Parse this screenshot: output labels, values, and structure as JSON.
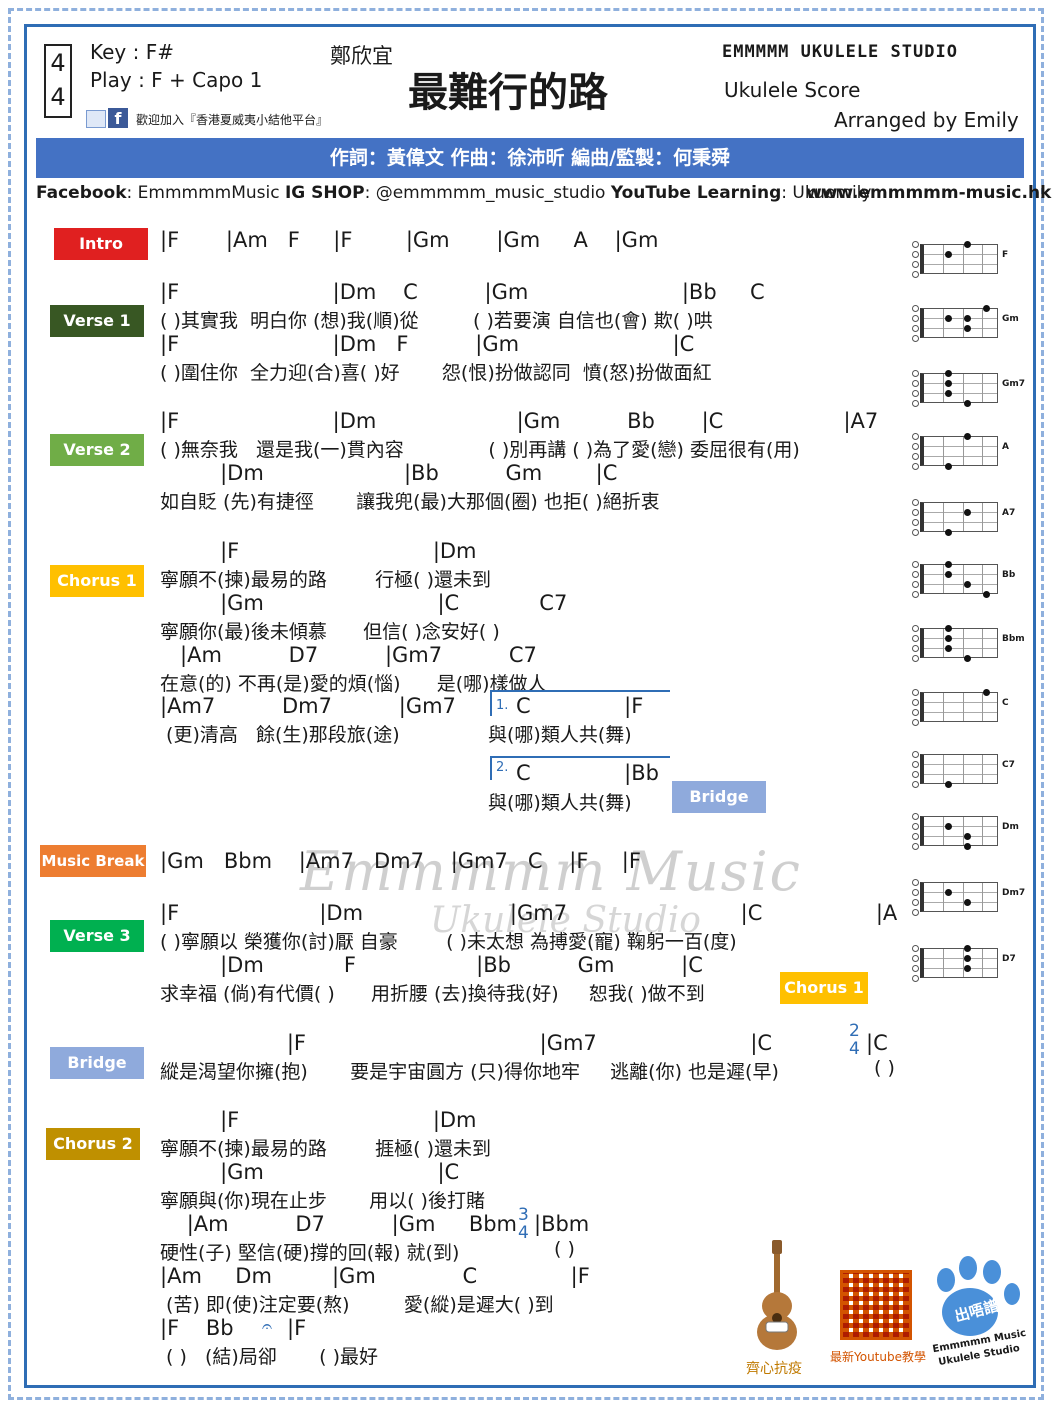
{
  "header": {
    "time_top": "4",
    "time_bottom": "4",
    "key": "Key : F#",
    "play": "Play : F + Capo 1",
    "welcome": "歡迎加入『香港夏威夷小結他平台』",
    "artist": "鄭欣宜",
    "title": "最難行的路",
    "studio": "EMMMMM UKULELE STUDIO",
    "score_type": "Ukulele Score",
    "arranger": "Arranged by Emily"
  },
  "credits": "作詞：黃偉文  作曲：徐沛昕    編曲/監製：何秉舜",
  "social": {
    "fb_label": "Facebook",
    "fb_value": ": EmmmmmMusic ",
    "ig_label": "IG SHOP",
    "ig_value": ": @emmmmm_music_studio ",
    "yt_label": "YouTube Learning",
    "yt_value": ": Ukuemily ",
    "web": "www.emmmmm-music.hk"
  },
  "sections": {
    "intro": "Intro",
    "verse1": "Verse 1",
    "verse2": "Verse 2",
    "chorus1": "Chorus 1",
    "music_break": "Music Break",
    "verse3": "Verse 3",
    "bridge": "Bridge",
    "chorus2": "Chorus 2",
    "bridge_tag": "Bridge",
    "chorus1_tag": "Chorus 1"
  },
  "colors": {
    "intro": "#e02020",
    "verse1": "#385723",
    "verse2": "#70ad47",
    "chorus1": "#ffc000",
    "music_break": "#ed7d31",
    "verse3": "#00b050",
    "bridge": "#8faadc",
    "chorus2": "#bf9000",
    "banner": "#4472c4"
  },
  "intro_chords": "|F       |Am   F     |F        |Gm       |Gm     A    |Gm",
  "verse1": [
    "|F                       |Dm    C          |Gm                       |Bb     C",
    "( )其實我  明白你 (想)我(順)從         ( )若要演 自信也(會) 欺( )哄",
    "|F                       |Dm   F          |Gm                       |C",
    "( )圍住你  全力迎(合)喜( )好       怨(恨)扮做認同  憤(怒)扮做面紅"
  ],
  "verse2": [
    "|F                       |Dm                     |Gm          Bb       |C                  |A7",
    "( )無奈我   還是我(一)貫內容              ( )別再講 ( )為了愛(戀) 委屈很有(用)",
    "         |Dm                     |Bb          Gm        |C",
    "如自貶 (先)有捷徑       讓我兜(最)大那個(圈) 也拒( )絕折衷"
  ],
  "chorus1": [
    "         |F                             |Dm",
    "寧願不(揀)最易的路        行極( )還未到",
    "         |Gm                          |C            C7",
    "寧願你(最)後未傾慕      但信( )念安好( )",
    "   |Am          D7          |Gm7          C7",
    "在意(的) 不再(是)愛的煩(惱)      是(哪)樣做人",
    "|Am7          Dm7          |Gm7",
    " (更)清高   餘(生)那段旅(途)"
  ],
  "ending1": {
    "num": "1.",
    "chords": "C              |F",
    "lyric": "與(哪)類人共(舞)"
  },
  "ending2": {
    "num": "2.",
    "chords": "C              |Bb",
    "lyric": "與(哪)類人共(舞)"
  },
  "music_break_chords": "|Gm   Bbm    |Am7   Dm7    |Gm7   C    |F     |F",
  "verse3": [
    "|F                     |Dm                      |Gm7                          |C                 |A",
    "( )寧願以 榮獲你(討)厭 自豪        ( )未太想 為搏愛(寵) 鞠躬一百(度)",
    "         |Dm            F                  |Bb          Gm          |C",
    "求幸福 (倘)有代價( )      用折腰 (去)換待我(好)     恕我( )做不到"
  ],
  "bridge": [
    "                   |F                                   |Gm7                       |C",
    "縱是渴望你擁(抱)       要是宇宙圓方 (只)得你地牢     逃離(你) 也是遲(早)"
  ],
  "bridge_ts": {
    "top": "2",
    "bottom": "4",
    "chord": "|C",
    "lyric": "( )"
  },
  "chorus2": [
    "         |F                             |Dm",
    "寧願不(揀)最易的路        捱極( )還未到",
    "         |Gm                          |C",
    "寧願與(你)現在止步       用以( )後打賭",
    "    |Am          D7          |Gm     Bbm",
    "硬性(子) 堅信(硬)撐的回(報) 就(到)",
    "|Am     Dm         |Gm             C              |F",
    " (苦) 即(使)注定要(熬)         愛(縱)是遲大( )到",
    "|F    Bb        |F",
    " ( )   (結)局卻       ( )最好"
  ],
  "chorus2_ts": {
    "top": "3",
    "bottom": "4",
    "chord": "|Bbm",
    "lyric": "( )"
  },
  "chord_diagrams": [
    {
      "name": "F"
    },
    {
      "name": "Gm"
    },
    {
      "name": "Gm7"
    },
    {
      "name": "A"
    },
    {
      "name": "A7"
    },
    {
      "name": "Bb"
    },
    {
      "name": "Bbm"
    },
    {
      "name": "C"
    },
    {
      "name": "C7"
    },
    {
      "name": "Dm"
    },
    {
      "name": "Dm7"
    },
    {
      "name": "D7"
    }
  ],
  "watermark": "Emmmmm Music",
  "watermark2": "Ukulele Studio",
  "footer": {
    "ukulele_caption": "齊心抗疫",
    "qr_caption": "最新Youtube教學",
    "paw_text": "出唔譜",
    "paw_caption1": "Emmmmm Music",
    "paw_caption2": "Ukulele Studio"
  }
}
